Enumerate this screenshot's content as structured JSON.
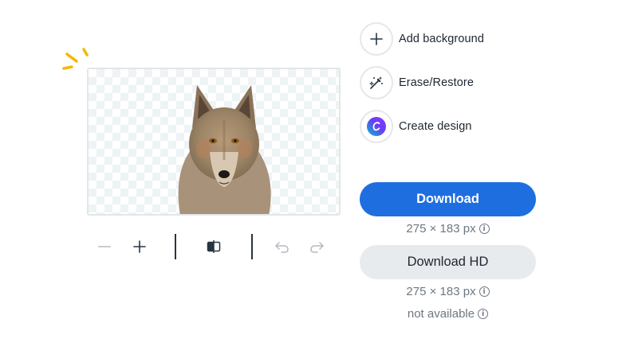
{
  "actions": {
    "add_background": {
      "label": "Add background",
      "icon": "plus-icon"
    },
    "erase_restore": {
      "label": "Erase/Restore",
      "icon": "magic-wand-icon"
    },
    "create_design": {
      "label": "Create design",
      "icon": "canva-logo-icon"
    }
  },
  "download": {
    "label": "Download",
    "size": "275 × 183 px",
    "info_icon": "info-icon"
  },
  "download_hd": {
    "label": "Download HD",
    "size": "275 × 183 px",
    "availability": "not available",
    "info_icon": "info-icon"
  },
  "toolbar": {
    "zoom_out_icon": "minus-icon",
    "zoom_in_icon": "plus-icon",
    "compare_icon": "compare-icon",
    "undo_icon": "undo-icon",
    "redo_icon": "redo-icon"
  },
  "colors": {
    "primary": "#1f6ee0",
    "secondary_bg": "#e8ebee",
    "sparkle": "#f5b800",
    "muted_text": "#6e7780"
  }
}
